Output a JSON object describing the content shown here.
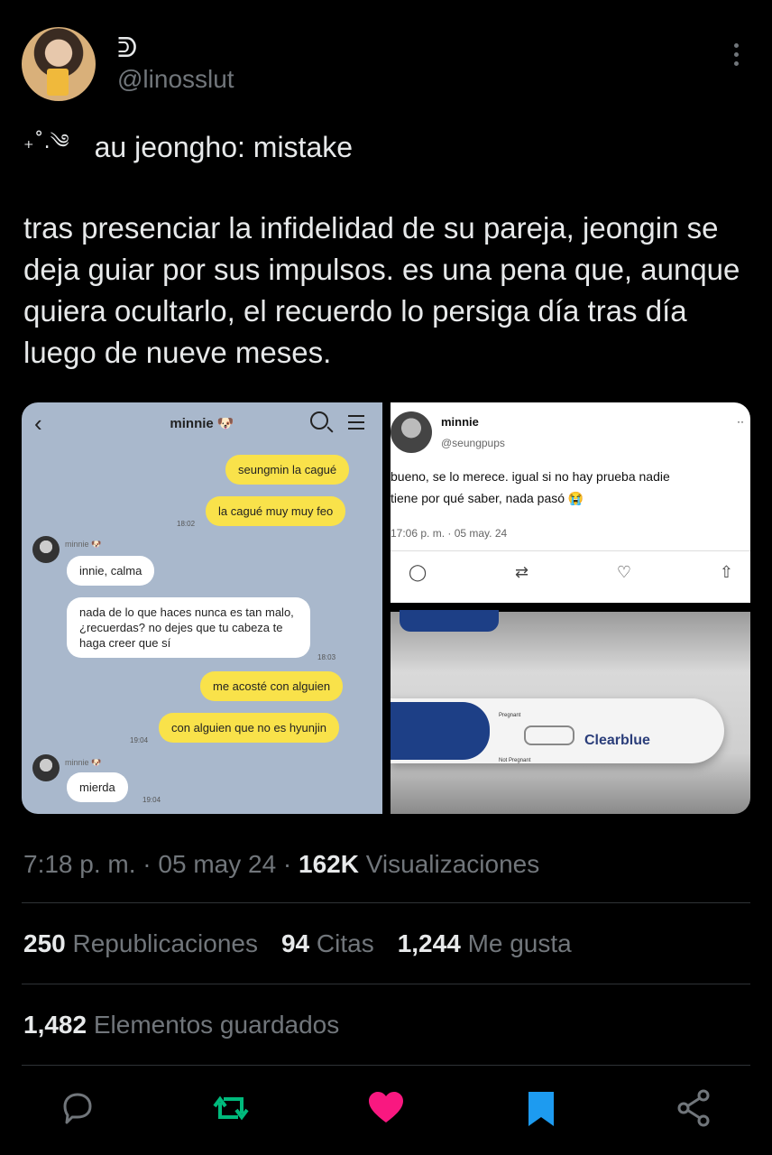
{
  "user": {
    "display_name": "ᕲ",
    "handle": "@linosslut"
  },
  "post": {
    "title_decoration": "₊˚.༄",
    "title": "au jeongho: mistake",
    "body": "tras presenciar la infidelidad de su pareja, jeongin se deja guiar por sus impulsos. es una pena que, aunque quiera ocultarlo, el recuerdo lo persiga día tras día luego de nueve meses."
  },
  "chat_image": {
    "title": "minnie 🐶",
    "messages": [
      {
        "side": "me",
        "text": "seungmin la cagué"
      },
      {
        "side": "me",
        "text": "la cagué muy muy feo",
        "time": "18:02"
      },
      {
        "side": "them",
        "name": "minnie 🐶",
        "text": "innie, calma"
      },
      {
        "side": "them",
        "text": "nada de lo que haces nunca es tan malo, ¿recuerdas? no dejes que tu cabeza te haga creer que sí",
        "time": "18:03"
      },
      {
        "side": "me",
        "text": "me acosté con alguien"
      },
      {
        "side": "me",
        "text": "con alguien que no es hyunjin",
        "time": "19:04"
      },
      {
        "side": "them",
        "name": "minnie 🐶",
        "text": "mierda",
        "time": "19:04"
      }
    ]
  },
  "tweet_image": {
    "name": "minnie",
    "handle": "@seungpups",
    "text_line1": "bueno, se lo merece. igual si no hay prueba nadie",
    "text_line2": "tiene por qué saber, nada pasó 😭",
    "time": "17:06 p. m. · 05 may. 24"
  },
  "photo_image": {
    "label_pregnant": "Pregnant",
    "label_not_pregnant": "Not Pregnant",
    "brand": "Clearblue"
  },
  "meta": {
    "time": "7:18 p. m. · 05 may 24 · ",
    "views_count": "162K",
    "views_label": "Visualizaciones"
  },
  "stats": {
    "reposts_count": "250",
    "reposts_label": "Republicaciones",
    "quotes_count": "94",
    "quotes_label": "Citas",
    "likes_count": "1,244",
    "likes_label": "Me gusta",
    "bookmarks_count": "1,482",
    "bookmarks_label": "Elementos guardados"
  },
  "colors": {
    "repost": "#00ba7c",
    "like": "#f91880",
    "bookmark": "#1d9bf0",
    "muted": "#71767b"
  }
}
